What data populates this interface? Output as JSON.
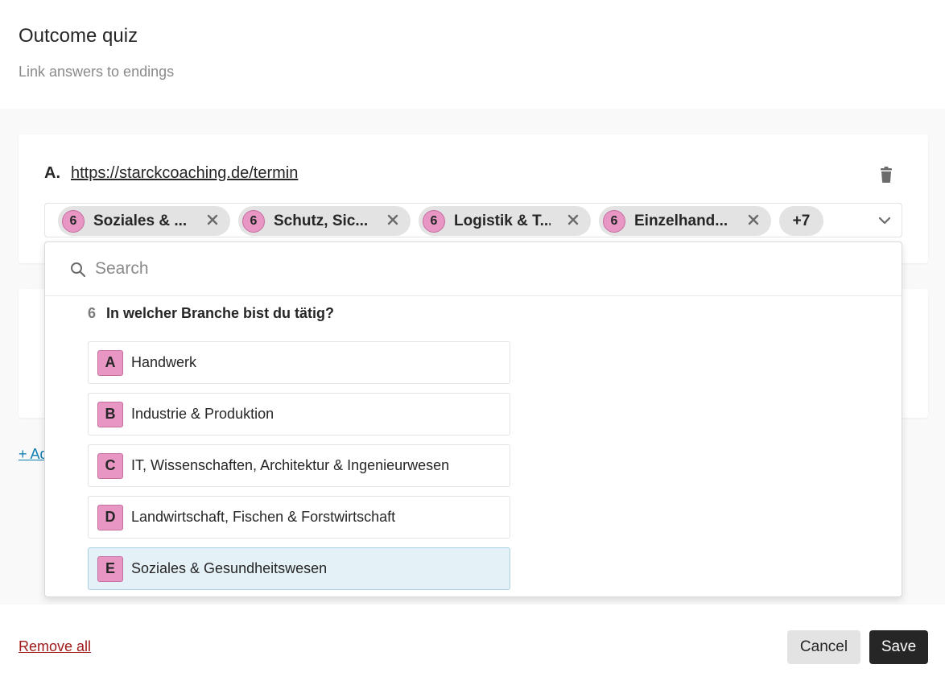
{
  "header": {
    "title": "Outcome quiz",
    "subtitle": "Link answers to endings"
  },
  "ending": {
    "letter": "A.",
    "url": "https://starckcoaching.de/termin",
    "trash_icon": "trash-icon"
  },
  "selected_chips": [
    {
      "number": "6",
      "label": "Soziales & ..."
    },
    {
      "number": "6",
      "label": "Schutz, Sic..."
    },
    {
      "number": "6",
      "label": "Logistik & T..."
    },
    {
      "number": "6",
      "label": "Einzelhand..."
    }
  ],
  "more_chips_label": "+7",
  "add_link_label": "+ Ad",
  "dropdown": {
    "search_placeholder": "Search",
    "question_number": "6",
    "question_text": "In welcher Branche bist du tätig?",
    "options": [
      {
        "key": "A",
        "label": "Handwerk",
        "selected": false
      },
      {
        "key": "B",
        "label": "Industrie & Produktion",
        "selected": false
      },
      {
        "key": "C",
        "label": "IT, Wissenschaften, Architektur & Ingenieurwesen",
        "selected": false
      },
      {
        "key": "D",
        "label": "Landwirtschaft, Fischen & Forstwirtschaft",
        "selected": false
      },
      {
        "key": "E",
        "label": "Soziales & Gesundheitswesen",
        "selected": true
      }
    ]
  },
  "footer": {
    "remove_all": "Remove all",
    "cancel": "Cancel",
    "save": "Save"
  },
  "colors": {
    "chip_badge": "#e896c3",
    "selected_option_bg": "#e4f1f6",
    "link": "#0b7fb0",
    "danger_link": "#a01919",
    "primary_button": "#262627"
  }
}
